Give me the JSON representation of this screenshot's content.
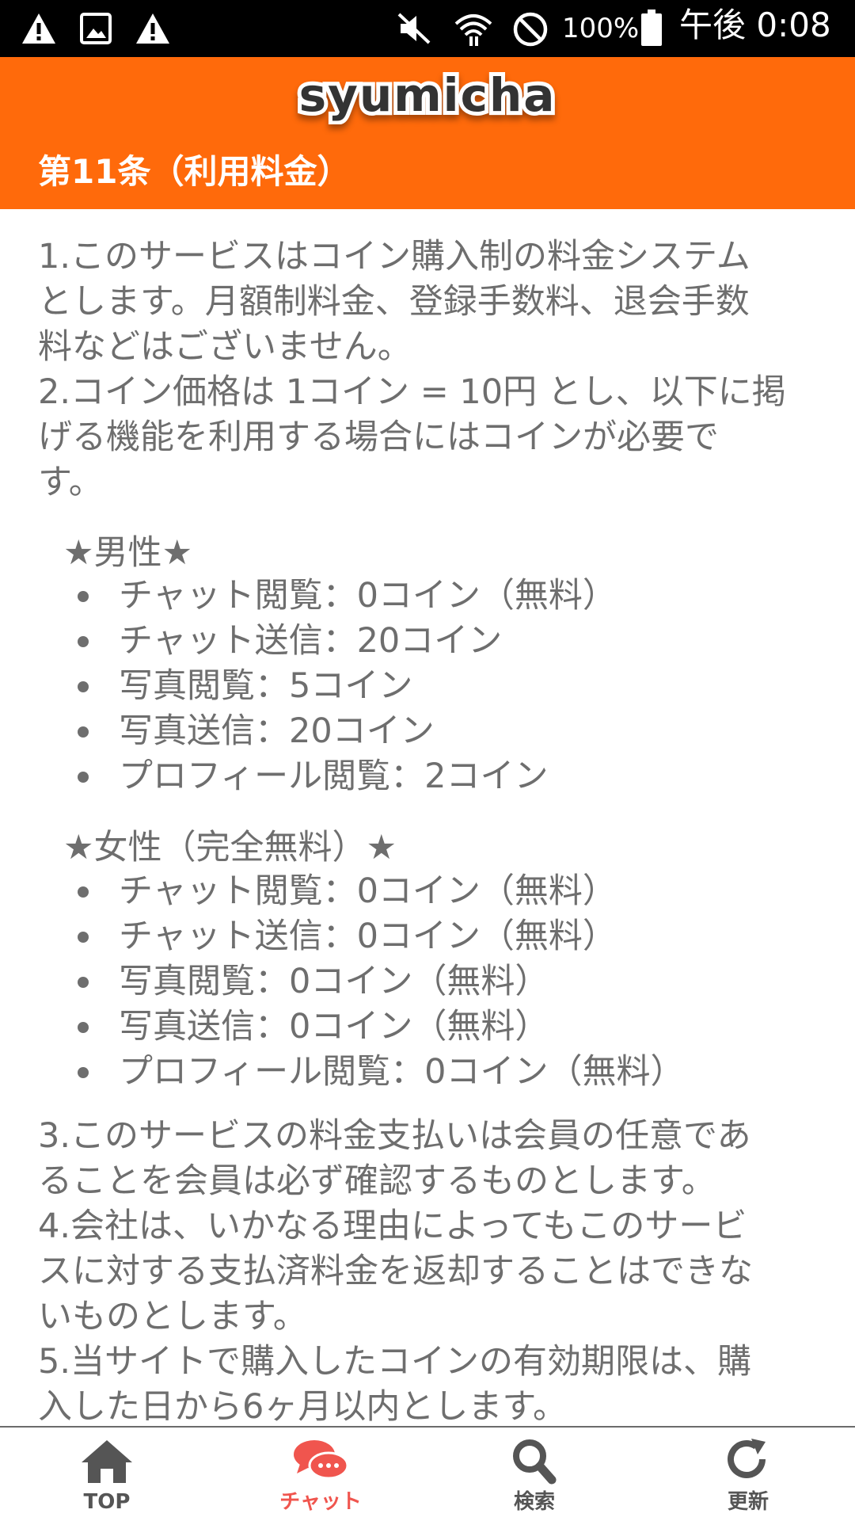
{
  "status_bar": {
    "battery": "100%",
    "time": "午後 0:08",
    "icons": [
      "warning-icon",
      "image-icon",
      "warning-icon",
      "mute-icon",
      "wifi-icon",
      "do-not-disturb-icon",
      "battery-icon"
    ]
  },
  "header": {
    "logo": "syumicha",
    "section_title": "第11条（利用料金）",
    "bg_color": "#ff6a0b"
  },
  "content": {
    "para1": "1.このサービスはコイン購入制の料金システム\nとします。月額制料金、登録手数料、退会手数\n料などはございません。\n2.コイン価格は 1コイン = 10円 とし、以下に掲\nげる機能を利用する場合にはコインが必要で\nす。",
    "male": {
      "title": "★男性★",
      "items": [
        "チャット閲覧：0コイン（無料）",
        "チャット送信：20コイン",
        "写真閲覧：5コイン",
        "写真送信：20コイン",
        "プロフィール閲覧：2コイン"
      ]
    },
    "female": {
      "title": "★女性（完全無料）★",
      "items": [
        "チャット閲覧：0コイン（無料）",
        "チャット送信：0コイン（無料）",
        "写真閲覧：0コイン（無料）",
        "写真送信：0コイン（無料）",
        "プロフィール閲覧：0コイン（無料）"
      ]
    },
    "para2": "3.このサービスの料金支払いは会員の任意であ\nることを会員は必ず確認するものとします。\n4.会社は、いかなる理由によってもこのサービ\nスに対する支払済料金を返却することはできな\nいものとします。\n5.当サイトで購入したコインの有効期限は、購\n入した日から6ヶ月以内とします。"
  },
  "nav": {
    "items": [
      {
        "label": "TOP",
        "icon": "home-icon"
      },
      {
        "label": "チャット",
        "icon": "chat-icon",
        "active": true
      },
      {
        "label": "検索",
        "icon": "search-icon"
      },
      {
        "label": "更新",
        "icon": "refresh-icon"
      }
    ],
    "active_color": "#f0554e"
  }
}
